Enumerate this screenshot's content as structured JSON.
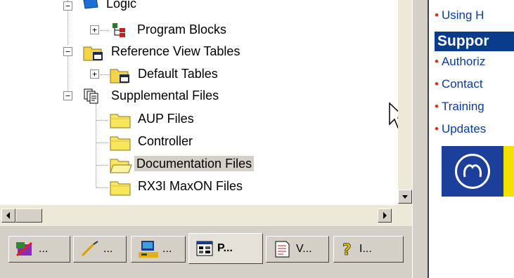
{
  "tree": {
    "items": [
      {
        "label": "Logic",
        "icon": "logic-icon"
      },
      {
        "label": "Program Blocks",
        "icon": "program-blocks-icon"
      },
      {
        "label": "Reference View Tables",
        "icon": "folder-table-icon"
      },
      {
        "label": "Default Tables",
        "icon": "folder-table-icon"
      },
      {
        "label": "Supplemental Files",
        "icon": "supplemental-files-icon"
      },
      {
        "label": "AUP Files",
        "icon": "folder-icon"
      },
      {
        "label": "Controller",
        "icon": "folder-icon"
      },
      {
        "label": "Documentation Files",
        "icon": "folder-open-icon",
        "selected": true
      },
      {
        "label": "RX3I MaxON Files",
        "icon": "folder-icon"
      }
    ],
    "expand_glyphs": {
      "expanded": "−",
      "collapsed": "+"
    }
  },
  "tabs": [
    {
      "label": "...",
      "icon": "project-icon"
    },
    {
      "label": "...",
      "icon": "variables-icon"
    },
    {
      "label": "...",
      "icon": "toolchest-icon"
    },
    {
      "label": "P...",
      "icon": "properties-icon",
      "active": true
    },
    {
      "label": "V...",
      "icon": "view-icon"
    },
    {
      "label": "I...",
      "icon": "help-icon"
    }
  ],
  "help_panel": {
    "links": [
      "Using H",
      "Authoriz",
      "Contact",
      "Training",
      "Updates"
    ],
    "support_heading": "Suppor",
    "bullet": "•",
    "logo": "ge-logo",
    "colors": {
      "link": "#0a3c9c",
      "bullet": "#e0301e",
      "heading_bg": "#0a3c8c"
    }
  }
}
